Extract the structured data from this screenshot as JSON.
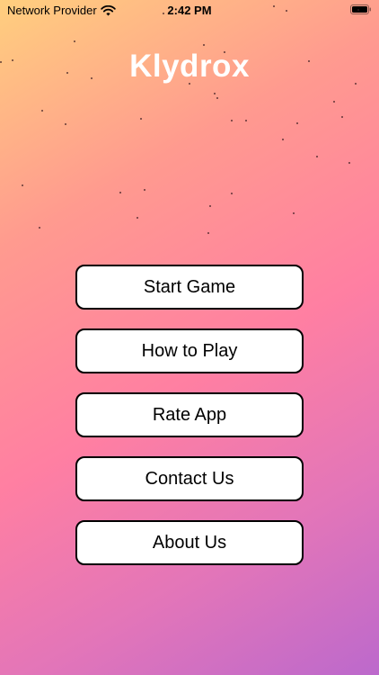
{
  "status_bar": {
    "carrier": "Network Provider",
    "time": "2:42 PM"
  },
  "app": {
    "title": "Klydrox"
  },
  "menu": {
    "items": [
      {
        "label": "Start Game"
      },
      {
        "label": "How to Play"
      },
      {
        "label": "Rate App"
      },
      {
        "label": "Contact Us"
      },
      {
        "label": "About Us"
      }
    ]
  },
  "icons": {
    "signal": "wifi-icon",
    "battery": "battery-icon"
  },
  "colors": {
    "gradient_start": "#ffcf7e",
    "gradient_mid": "#ff7fa2",
    "gradient_end": "#bc69cc",
    "button_background": "#ffffff",
    "button_border": "#000000",
    "title_color": "#ffffff"
  }
}
